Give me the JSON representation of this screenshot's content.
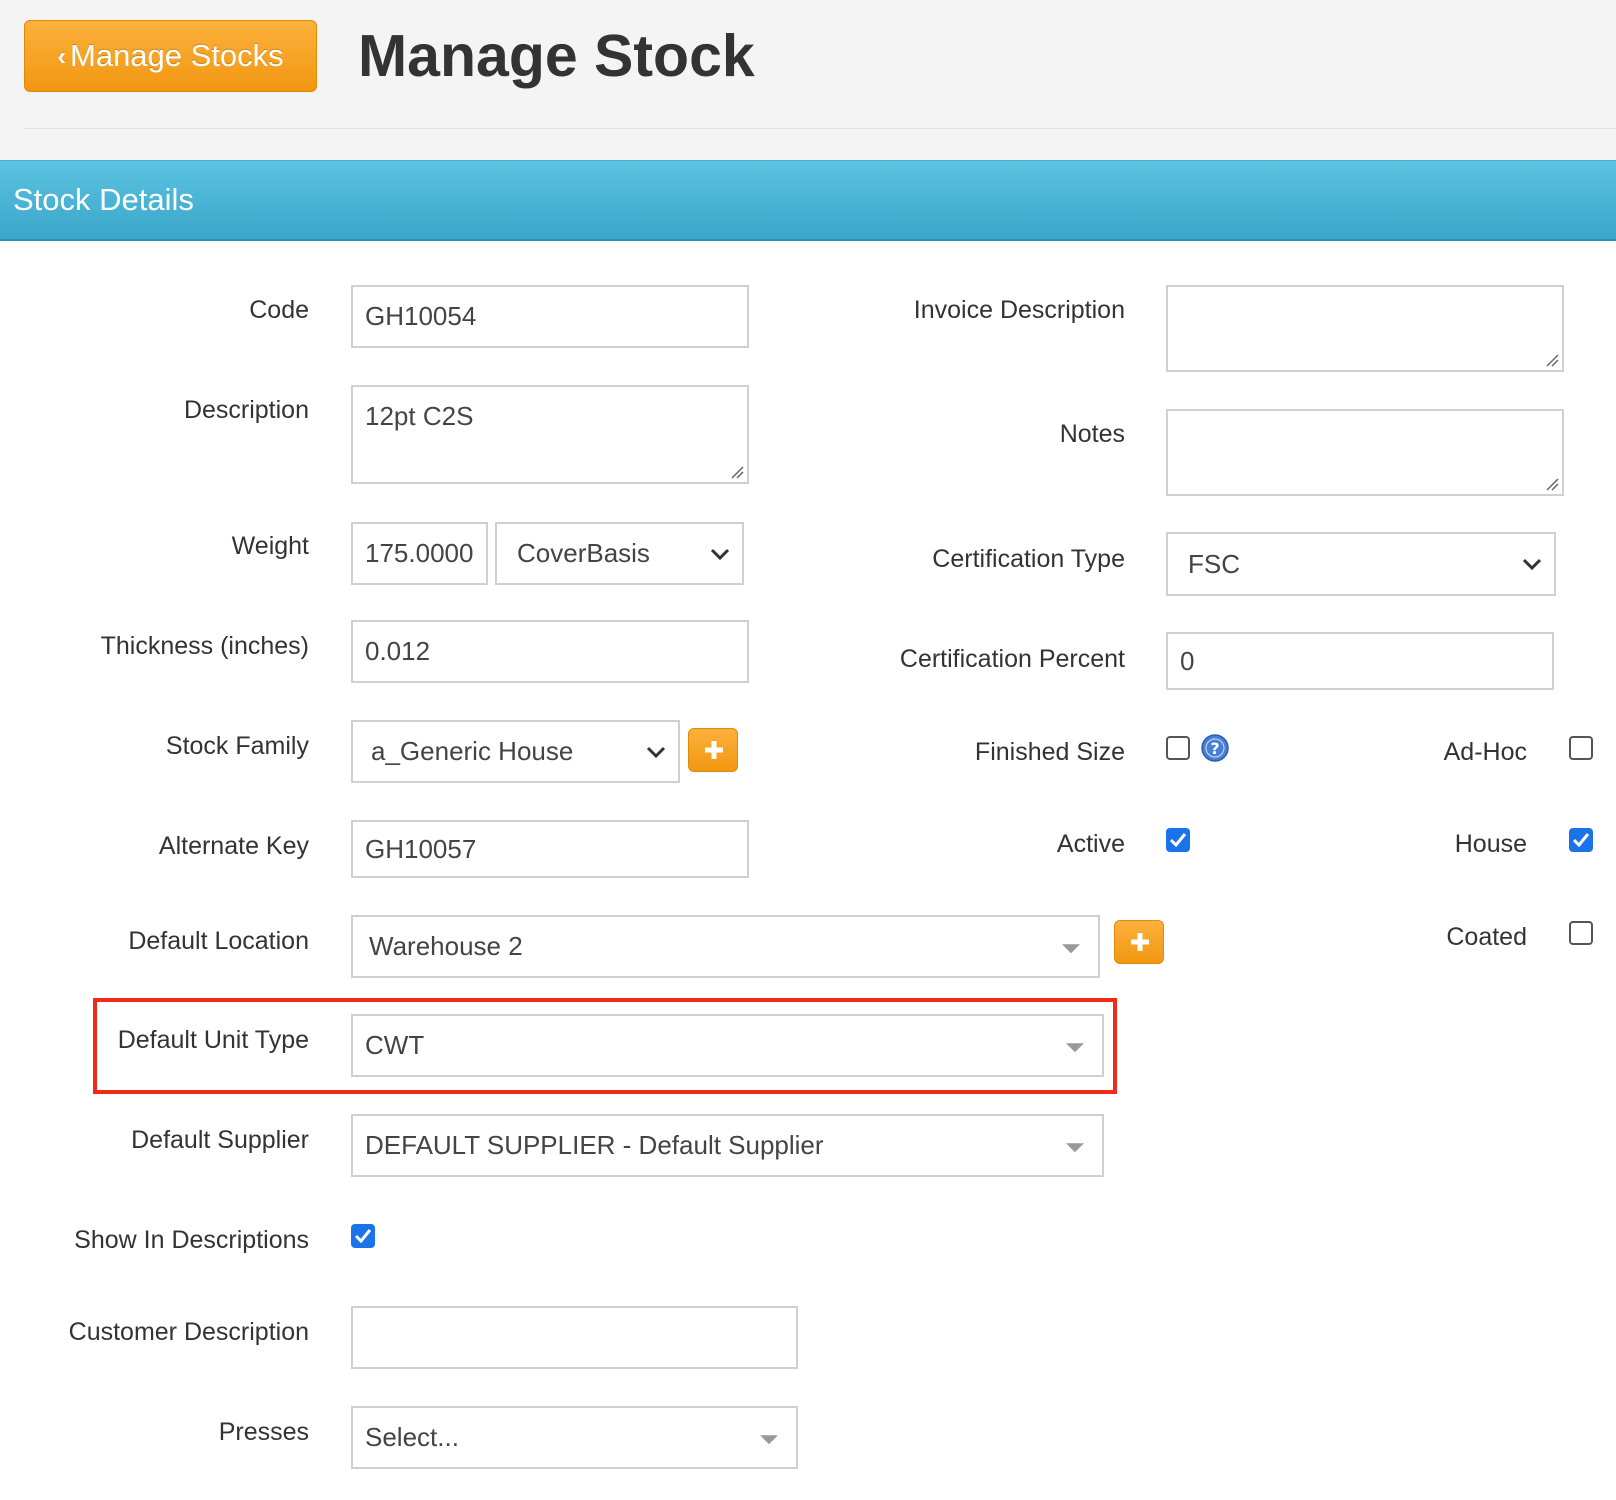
{
  "header": {
    "back_button": "Manage Stocks",
    "title": "Manage Stock"
  },
  "section": {
    "title": "Stock Details"
  },
  "form": {
    "code": {
      "label": "Code",
      "value": "GH10054"
    },
    "description": {
      "label": "Description",
      "value": "12pt C2S"
    },
    "weight": {
      "label": "Weight",
      "value": "175.0000",
      "basis": "CoverBasis"
    },
    "thickness": {
      "label": "Thickness (inches)",
      "value": "0.012"
    },
    "stock_family": {
      "label": "Stock Family",
      "value": "a_Generic House"
    },
    "alternate_key": {
      "label": "Alternate Key",
      "value": "GH10057"
    },
    "default_location": {
      "label": "Default Location",
      "value": "Warehouse 2"
    },
    "default_unit_type": {
      "label": "Default Unit Type",
      "value": "CWT"
    },
    "default_supplier": {
      "label": "Default Supplier",
      "value": "DEFAULT SUPPLIER - Default Supplier"
    },
    "show_in_descriptions": {
      "label": "Show In Descriptions",
      "checked": true
    },
    "customer_description": {
      "label": "Customer Description",
      "value": ""
    },
    "presses": {
      "label": "Presses",
      "value": "Select..."
    },
    "invoice_description": {
      "label": "Invoice Description",
      "value": ""
    },
    "notes": {
      "label": "Notes",
      "value": ""
    },
    "certification_type": {
      "label": "Certification Type",
      "value": "FSC"
    },
    "certification_percent": {
      "label": "Certification Percent",
      "value": "0"
    },
    "finished_size": {
      "label": "Finished Size",
      "checked": false
    },
    "active": {
      "label": "Active",
      "checked": true
    },
    "ad_hoc": {
      "label": "Ad-Hoc",
      "checked": false
    },
    "house": {
      "label": "House",
      "checked": true
    },
    "coated": {
      "label": "Coated",
      "checked": false
    }
  },
  "colors": {
    "accent_orange": "#f29711",
    "section_blue": "#4ab5d8",
    "checkbox_blue": "#1a73e8",
    "highlight_red": "#f12a1a"
  }
}
